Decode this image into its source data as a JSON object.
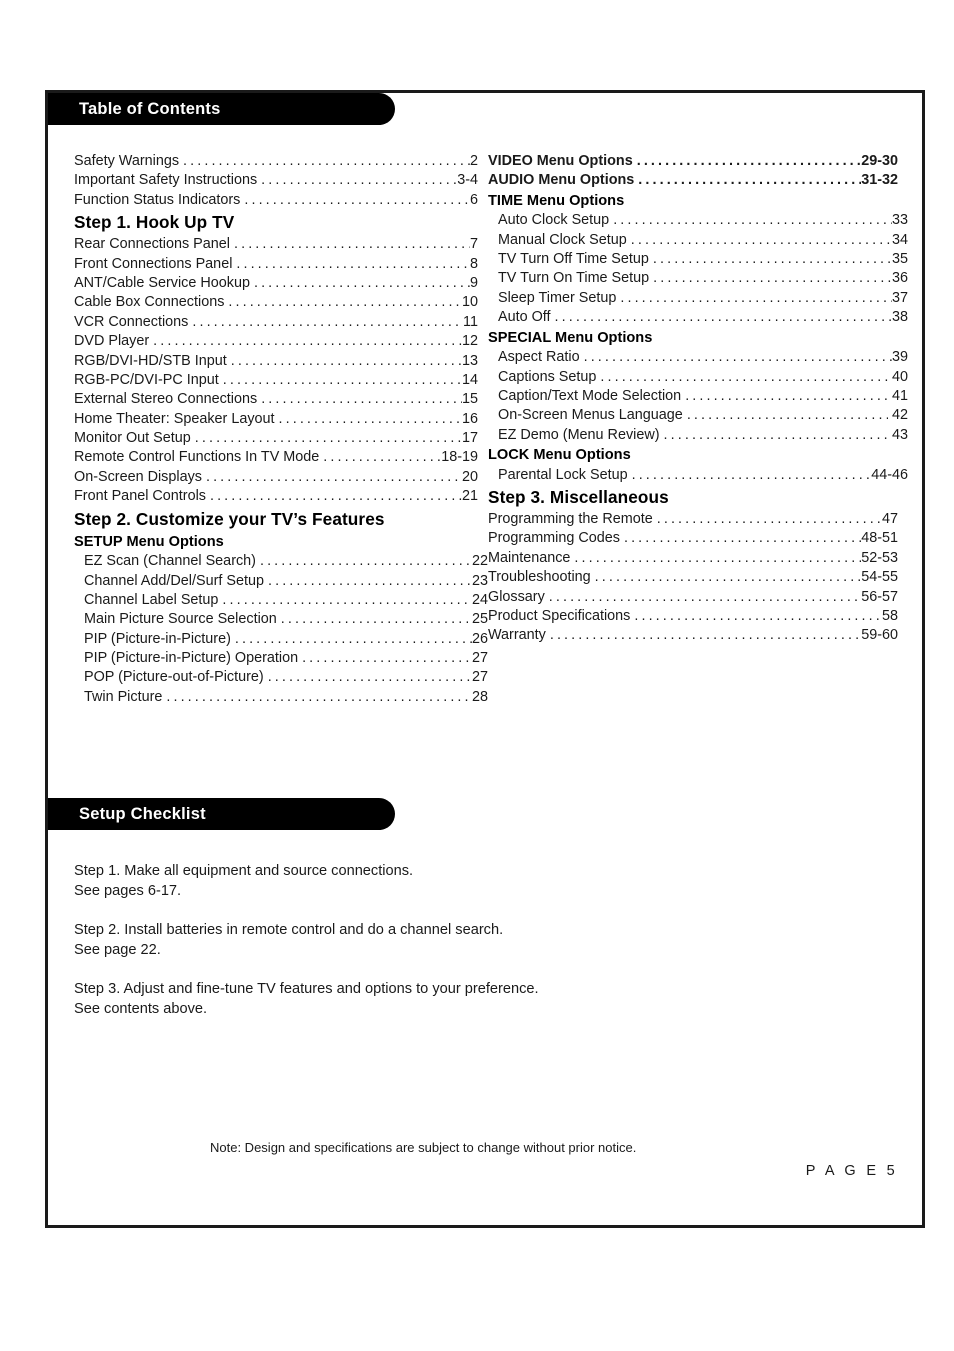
{
  "page": {
    "footer_note": "Note: Design and specifications are subject to change without prior notice.",
    "page_label": "P A G E  5"
  },
  "toc": {
    "bar_title": "Table of Contents",
    "left_column": [
      {
        "type": "entry",
        "label": "Safety Warnings",
        "page": "2"
      },
      {
        "type": "entry",
        "label": "Important Safety Instructions",
        "page": "3-4"
      },
      {
        "type": "entry",
        "label": "Function Status Indicators",
        "page": "6"
      },
      {
        "type": "head-major",
        "label": "Step 1. Hook Up TV"
      },
      {
        "type": "entry",
        "label": "Rear Connections Panel",
        "page": "7"
      },
      {
        "type": "entry",
        "label": "Front Connections Panel",
        "page": "8"
      },
      {
        "type": "entry",
        "label": "ANT/Cable Service Hookup",
        "page": "9"
      },
      {
        "type": "entry",
        "label": "Cable Box Connections",
        "page": "10"
      },
      {
        "type": "entry",
        "label": "VCR Connections",
        "page": "11"
      },
      {
        "type": "entry",
        "label": "DVD Player",
        "page": "12"
      },
      {
        "type": "entry",
        "label": "RGB/DVI-HD/STB Input",
        "page": "13"
      },
      {
        "type": "entry",
        "label": "RGB-PC/DVI-PC Input",
        "page": "14"
      },
      {
        "type": "entry",
        "label": "External Stereo Connections",
        "page": "15"
      },
      {
        "type": "entry",
        "label": "Home Theater: Speaker Layout",
        "page": "16"
      },
      {
        "type": "entry",
        "label": "Monitor Out Setup",
        "page": "17"
      },
      {
        "type": "entry",
        "label": "Remote Control Functions In TV Mode",
        "page": "18-19"
      },
      {
        "type": "entry",
        "label": "On-Screen Displays",
        "page": "20"
      },
      {
        "type": "entry",
        "label": "Front Panel Controls",
        "page": "21"
      },
      {
        "type": "head-major",
        "label": "Step 2. Customize your TV’s Features"
      },
      {
        "type": "head-minor",
        "label": "SETUP Menu Options"
      },
      {
        "type": "entry",
        "label": "EZ Scan (Channel Search)",
        "page": "22",
        "indent": true
      },
      {
        "type": "entry",
        "label": "Channel Add/Del/Surf Setup",
        "page": "23",
        "indent": true
      },
      {
        "type": "entry",
        "label": "Channel Label Setup",
        "page": "24",
        "indent": true
      },
      {
        "type": "entry",
        "label": "Main Picture Source Selection",
        "page": "25",
        "indent": true,
        "space_page": true
      },
      {
        "type": "entry",
        "label": "PIP (Picture-in-Picture)",
        "page": "26",
        "indent": true
      },
      {
        "type": "entry",
        "label": "PIP (Picture-in-Picture) Operation",
        "page": "27",
        "indent": true
      },
      {
        "type": "entry",
        "label": "POP (Picture-out-of-Picture)",
        "page": "27",
        "indent": true
      },
      {
        "type": "entry",
        "label": "Twin Picture",
        "page": "28",
        "indent": true
      }
    ],
    "right_column": [
      {
        "type": "entry",
        "label": "VIDEO Menu Options",
        "page": "29-30",
        "bold": true
      },
      {
        "type": "entry",
        "label": "AUDIO Menu Options",
        "page": "31-32",
        "bold": true
      },
      {
        "type": "head-minor",
        "label": "TIME Menu Options"
      },
      {
        "type": "entry",
        "label": "Auto Clock Setup",
        "page": "33",
        "indent": true
      },
      {
        "type": "entry",
        "label": "Manual Clock Setup",
        "page": "34",
        "indent": true
      },
      {
        "type": "entry",
        "label": "TV Turn Off Time Setup",
        "page": "35",
        "indent": true
      },
      {
        "type": "entry",
        "label": "TV Turn On Time Setup",
        "page": "36",
        "indent": true
      },
      {
        "type": "entry",
        "label": "Sleep Timer Setup",
        "page": "37",
        "indent": true
      },
      {
        "type": "entry",
        "label": "Auto Off",
        "page": "38",
        "indent": true
      },
      {
        "type": "head-minor",
        "label": "SPECIAL Menu Options"
      },
      {
        "type": "entry",
        "label": "Aspect Ratio",
        "page": "39",
        "indent": true
      },
      {
        "type": "entry",
        "label": "Captions Setup",
        "page": "40",
        "indent": true
      },
      {
        "type": "entry",
        "label": "Caption/Text Mode Selection",
        "page": "41",
        "indent": true
      },
      {
        "type": "entry",
        "label": "On-Screen Menus Language",
        "page": "42",
        "indent": true,
        "space_page": true
      },
      {
        "type": "entry",
        "label": "EZ Demo (Menu Review)",
        "page": "43",
        "indent": true
      },
      {
        "type": "head-minor",
        "label": "LOCK Menu Options"
      },
      {
        "type": "entry",
        "label": "Parental Lock Setup",
        "page": "44-46",
        "indent": true
      },
      {
        "type": "head-major",
        "label": "Step 3. Miscellaneous"
      },
      {
        "type": "entry",
        "label": "Programming the Remote",
        "page": "47"
      },
      {
        "type": "entry",
        "label": "Programming Codes",
        "page": "48-51"
      },
      {
        "type": "entry",
        "label": "Maintenance",
        "page": "52-53"
      },
      {
        "type": "entry",
        "label": "Troubleshooting",
        "page": "54-55"
      },
      {
        "type": "entry",
        "label": "Glossary",
        "page": "56-57"
      },
      {
        "type": "entry",
        "label": "Product Specifications",
        "page": "58"
      },
      {
        "type": "entry",
        "label": "Warranty",
        "page": "59-60"
      }
    ]
  },
  "setup_checklist": {
    "bar_title": "Setup Checklist",
    "steps": [
      {
        "line1": "Step 1. Make all equipment and source connections.",
        "line2": "See pages 6-17."
      },
      {
        "line1": "Step 2. Install batteries in remote control and do a channel search.",
        "line2": "See page 22."
      },
      {
        "line1": "Step 3. Adjust and fine-tune TV features and options to your preference.",
        "line2": "See contents above."
      }
    ]
  }
}
